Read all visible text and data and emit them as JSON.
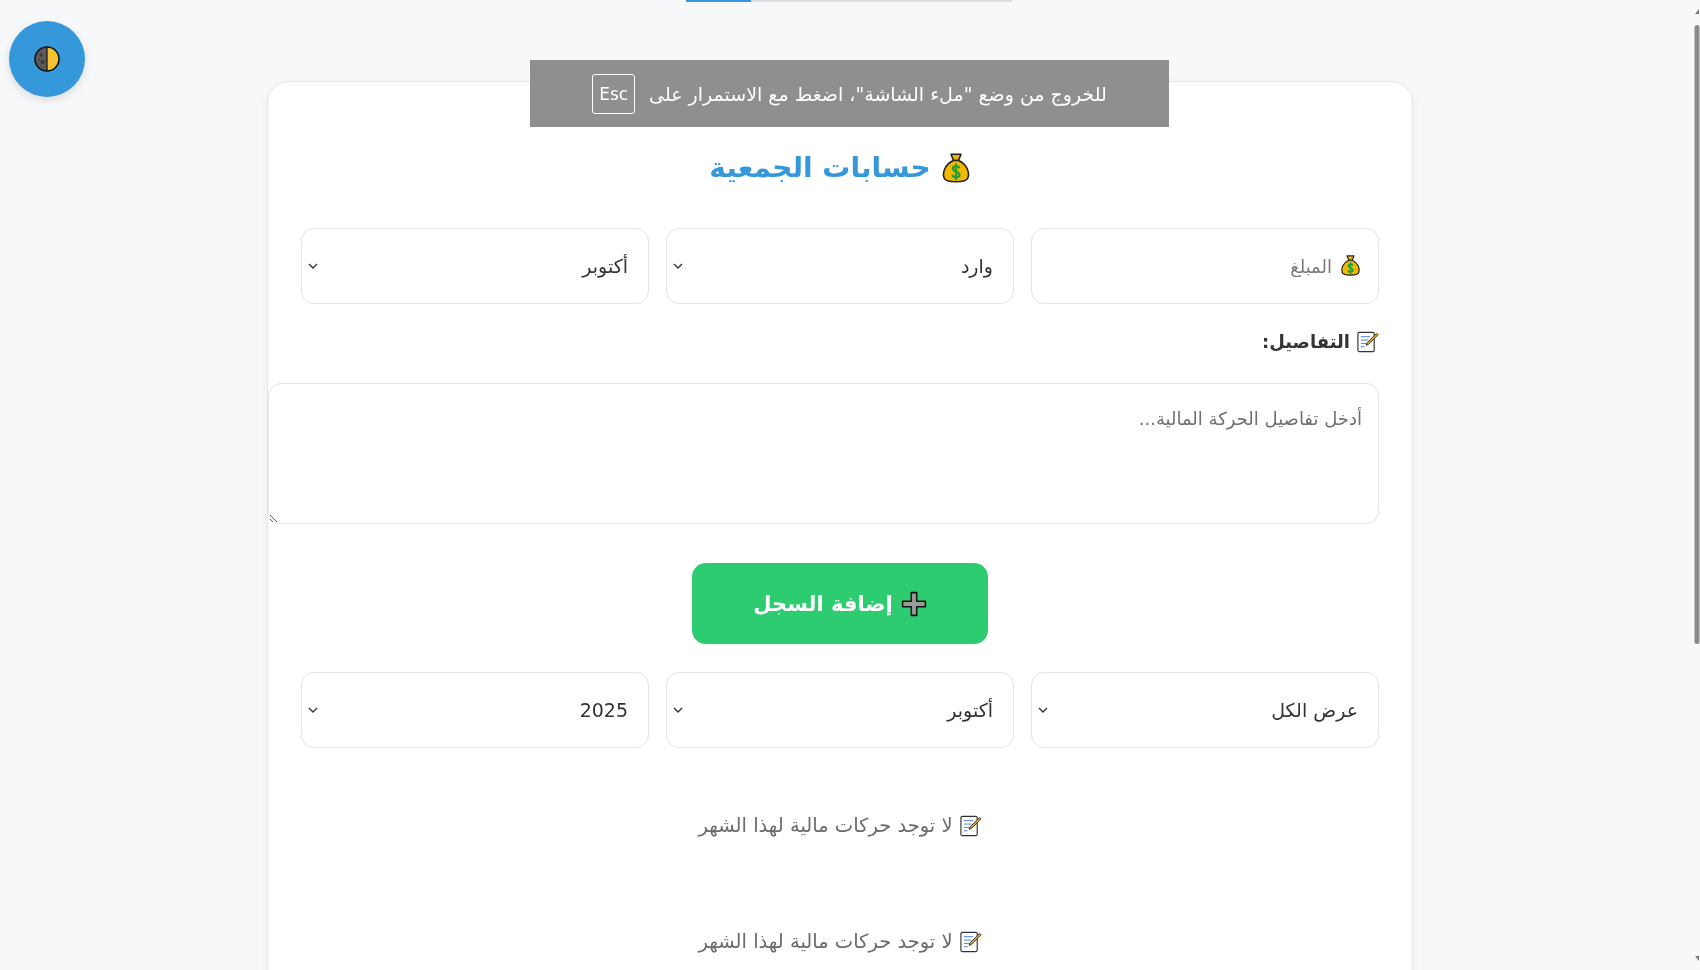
{
  "top_bar": {
    "level": 0.2
  },
  "fullscreen_notice": {
    "text": "للخروج من وضع \"ملء الشاشة\"، اضغط مع الاستمرار على",
    "key": "Esc"
  },
  "title": "حسابات الجمعية",
  "entry_form": {
    "amount": {
      "placeholder": "المبلغ"
    },
    "type_select": {
      "value": "وارد"
    },
    "month_select": {
      "value": "أكتوبر"
    },
    "details_label": "التفاصيل:",
    "details": {
      "placeholder": "أدخل تفاصيل الحركة المالية..."
    },
    "submit_button": "إضافة السجل"
  },
  "filters": [
    {
      "value": "عرض الكل"
    },
    {
      "value": "أكتوبر"
    },
    {
      "value": "2025"
    }
  ],
  "empty_messages": [
    "لا توجد حركات مالية لهذا الشهر",
    "لا توجد حركات مالية لهذا الشهر"
  ]
}
